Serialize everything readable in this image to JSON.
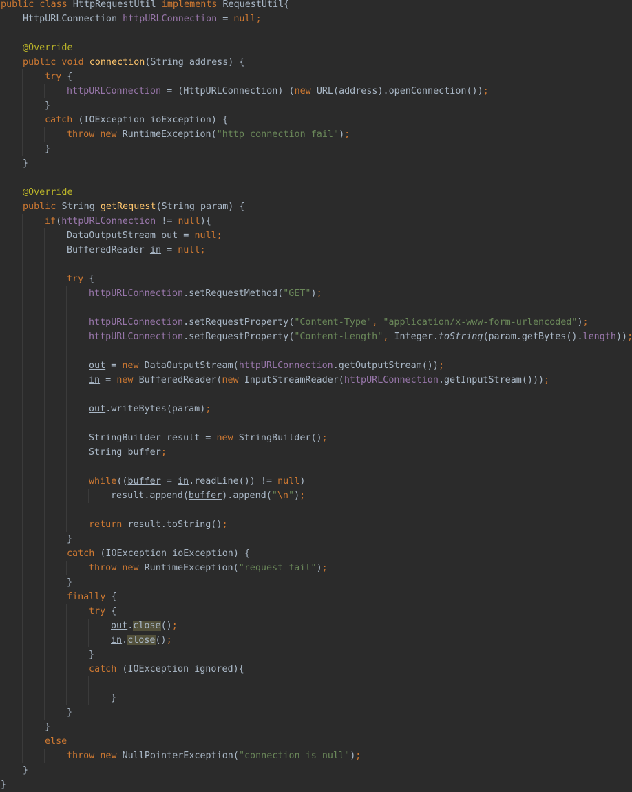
{
  "editor": {
    "language": "java",
    "colors": {
      "background": "#2b2b2b",
      "keyword": "#cc7832",
      "field": "#9876aa",
      "string": "#6a8759",
      "annotation": "#bbb529",
      "method_declaration": "#ffc66d",
      "plain": "#a9b7c6",
      "usage_highlight": "#52503a"
    },
    "lines": [
      {
        "indent": 0,
        "tokens": [
          [
            "kw",
            "public class "
          ],
          [
            "pl",
            "HttpRequestUtil "
          ],
          [
            "kw",
            "implements "
          ],
          [
            "pl",
            "RequestUtil{"
          ]
        ]
      },
      {
        "indent": 1,
        "tokens": [
          [
            "pl",
            "HttpURLConnection "
          ],
          [
            "fld",
            "httpURLConnection "
          ],
          [
            "pl",
            "= "
          ],
          [
            "kw",
            "null;"
          ]
        ]
      },
      {
        "indent": 0,
        "tokens": []
      },
      {
        "indent": 1,
        "tokens": [
          [
            "ann",
            "@Override"
          ]
        ]
      },
      {
        "indent": 1,
        "tokens": [
          [
            "kw",
            "public void "
          ],
          [
            "mth",
            "connection"
          ],
          [
            "pl",
            "(String address) {"
          ]
        ]
      },
      {
        "indent": 2,
        "tokens": [
          [
            "kw",
            "try "
          ],
          [
            "pl",
            "{"
          ]
        ]
      },
      {
        "indent": 3,
        "tokens": [
          [
            "fld",
            "httpURLConnection "
          ],
          [
            "pl",
            "= (HttpURLConnection) ("
          ],
          [
            "kw",
            "new "
          ],
          [
            "pl",
            "URL(address).openConnection())"
          ],
          [
            "kw",
            ";"
          ]
        ]
      },
      {
        "indent": 2,
        "tokens": [
          [
            "pl",
            "}"
          ]
        ]
      },
      {
        "indent": 2,
        "tokens": [
          [
            "kw",
            "catch "
          ],
          [
            "pl",
            "(IOException ioException) {"
          ]
        ]
      },
      {
        "indent": 3,
        "tokens": [
          [
            "kw",
            "throw new "
          ],
          [
            "pl",
            "RuntimeException("
          ],
          [
            "str",
            "\"http connection fail\""
          ],
          [
            "pl",
            ")"
          ],
          [
            "kw",
            ";"
          ]
        ]
      },
      {
        "indent": 2,
        "tokens": [
          [
            "pl",
            "}"
          ]
        ]
      },
      {
        "indent": 1,
        "tokens": [
          [
            "pl",
            "}"
          ]
        ]
      },
      {
        "indent": 0,
        "tokens": []
      },
      {
        "indent": 1,
        "tokens": [
          [
            "ann",
            "@Override"
          ]
        ]
      },
      {
        "indent": 1,
        "tokens": [
          [
            "kw",
            "public "
          ],
          [
            "pl",
            "String "
          ],
          [
            "mth",
            "getRequest"
          ],
          [
            "pl",
            "(String param) {"
          ]
        ]
      },
      {
        "indent": 2,
        "tokens": [
          [
            "kw",
            "if"
          ],
          [
            "pl",
            "("
          ],
          [
            "fld",
            "httpURLConnection "
          ],
          [
            "pl",
            "!= "
          ],
          [
            "kw",
            "null"
          ],
          [
            "pl",
            "){"
          ]
        ]
      },
      {
        "indent": 3,
        "tokens": [
          [
            "pl",
            "DataOutputStream "
          ],
          [
            "pl ul",
            "out"
          ],
          [
            "pl",
            " = "
          ],
          [
            "kw",
            "null;"
          ]
        ]
      },
      {
        "indent": 3,
        "tokens": [
          [
            "pl",
            "BufferedReader "
          ],
          [
            "pl ul",
            "in"
          ],
          [
            "pl",
            " = "
          ],
          [
            "kw",
            "null;"
          ]
        ]
      },
      {
        "indent": 0,
        "tokens": []
      },
      {
        "indent": 3,
        "tokens": [
          [
            "kw",
            "try "
          ],
          [
            "pl",
            "{"
          ]
        ]
      },
      {
        "indent": 4,
        "tokens": [
          [
            "fld",
            "httpURLConnection"
          ],
          [
            "pl",
            ".setRequestMethod("
          ],
          [
            "str",
            "\"GET\""
          ],
          [
            "pl",
            ")"
          ],
          [
            "kw",
            ";"
          ]
        ]
      },
      {
        "indent": 0,
        "tokens": []
      },
      {
        "indent": 4,
        "tokens": [
          [
            "fld",
            "httpURLConnection"
          ],
          [
            "pl",
            ".setRequestProperty("
          ],
          [
            "str",
            "\"Content-Type\""
          ],
          [
            "kw",
            ", "
          ],
          [
            "str",
            "\"application/x-www-form-urlencoded\""
          ],
          [
            "pl",
            ")"
          ],
          [
            "kw",
            ";"
          ]
        ]
      },
      {
        "indent": 4,
        "tokens": [
          [
            "fld",
            "httpURLConnection"
          ],
          [
            "pl",
            ".setRequestProperty("
          ],
          [
            "str",
            "\"Content-Length\""
          ],
          [
            "kw",
            ", "
          ],
          [
            "pl",
            "Integer."
          ],
          [
            "pl it",
            "toString"
          ],
          [
            "pl",
            "(param.getBytes()."
          ],
          [
            "fld",
            "length"
          ],
          [
            "pl",
            "))"
          ],
          [
            "kw",
            ";"
          ]
        ]
      },
      {
        "indent": 0,
        "tokens": []
      },
      {
        "indent": 4,
        "tokens": [
          [
            "pl ul",
            "out"
          ],
          [
            "pl",
            " = "
          ],
          [
            "kw",
            "new "
          ],
          [
            "pl",
            "DataOutputStream("
          ],
          [
            "fld",
            "httpURLConnection"
          ],
          [
            "pl",
            ".getOutputStream())"
          ],
          [
            "kw",
            ";"
          ]
        ]
      },
      {
        "indent": 4,
        "tokens": [
          [
            "pl ul",
            "in"
          ],
          [
            "pl",
            " = "
          ],
          [
            "kw",
            "new "
          ],
          [
            "pl",
            "BufferedReader("
          ],
          [
            "kw",
            "new "
          ],
          [
            "pl",
            "InputStreamReader("
          ],
          [
            "fld",
            "httpURLConnection"
          ],
          [
            "pl",
            ".getInputStream()))"
          ],
          [
            "kw",
            ";"
          ]
        ]
      },
      {
        "indent": 0,
        "tokens": []
      },
      {
        "indent": 4,
        "tokens": [
          [
            "pl ul",
            "out"
          ],
          [
            "pl",
            ".writeBytes(param)"
          ],
          [
            "kw",
            ";"
          ]
        ]
      },
      {
        "indent": 0,
        "tokens": []
      },
      {
        "indent": 4,
        "tokens": [
          [
            "pl",
            "StringBuilder result = "
          ],
          [
            "kw",
            "new "
          ],
          [
            "pl",
            "StringBuilder()"
          ],
          [
            "kw",
            ";"
          ]
        ]
      },
      {
        "indent": 4,
        "tokens": [
          [
            "pl",
            "String "
          ],
          [
            "pl ul",
            "buffer"
          ],
          [
            "kw",
            ";"
          ]
        ]
      },
      {
        "indent": 0,
        "tokens": []
      },
      {
        "indent": 4,
        "tokens": [
          [
            "kw",
            "while"
          ],
          [
            "pl",
            "(("
          ],
          [
            "pl ul",
            "buffer"
          ],
          [
            "pl",
            " = "
          ],
          [
            "pl ul",
            "in"
          ],
          [
            "pl",
            ".readLine()) != "
          ],
          [
            "kw",
            "null"
          ],
          [
            "pl",
            ")"
          ]
        ]
      },
      {
        "indent": 5,
        "tokens": [
          [
            "pl",
            "result.append("
          ],
          [
            "pl ul",
            "buffer"
          ],
          [
            "pl",
            ").append("
          ],
          [
            "str",
            "\""
          ],
          [
            "kw",
            "\\n"
          ],
          [
            "str",
            "\""
          ],
          [
            "pl",
            ")"
          ],
          [
            "kw",
            ";"
          ]
        ]
      },
      {
        "indent": 0,
        "tokens": []
      },
      {
        "indent": 4,
        "tokens": [
          [
            "kw",
            "return "
          ],
          [
            "pl",
            "result.toString()"
          ],
          [
            "kw",
            ";"
          ]
        ]
      },
      {
        "indent": 3,
        "tokens": [
          [
            "pl",
            "}"
          ]
        ]
      },
      {
        "indent": 3,
        "tokens": [
          [
            "kw",
            "catch "
          ],
          [
            "pl",
            "(IOException ioException) {"
          ]
        ]
      },
      {
        "indent": 4,
        "tokens": [
          [
            "kw",
            "throw new "
          ],
          [
            "pl",
            "RuntimeException("
          ],
          [
            "str",
            "\"request fail\""
          ],
          [
            "pl",
            ")"
          ],
          [
            "kw",
            ";"
          ]
        ]
      },
      {
        "indent": 3,
        "tokens": [
          [
            "pl",
            "}"
          ]
        ]
      },
      {
        "indent": 3,
        "tokens": [
          [
            "kw",
            "finally "
          ],
          [
            "pl",
            "{"
          ]
        ]
      },
      {
        "indent": 4,
        "tokens": [
          [
            "kw",
            "try "
          ],
          [
            "pl",
            "{"
          ]
        ]
      },
      {
        "indent": 5,
        "tokens": [
          [
            "pl ul",
            "out"
          ],
          [
            "pl",
            "."
          ],
          [
            "pl hl",
            "close"
          ],
          [
            "pl",
            "()"
          ],
          [
            "kw",
            ";"
          ]
        ]
      },
      {
        "indent": 5,
        "tokens": [
          [
            "pl ul",
            "in"
          ],
          [
            "pl",
            "."
          ],
          [
            "pl hl",
            "close"
          ],
          [
            "pl",
            "()"
          ],
          [
            "kw",
            ";"
          ]
        ]
      },
      {
        "indent": 4,
        "tokens": [
          [
            "pl",
            "}"
          ]
        ]
      },
      {
        "indent": 4,
        "tokens": [
          [
            "kw",
            "catch "
          ],
          [
            "pl",
            "(IOException ignored){"
          ]
        ]
      },
      {
        "indent": 0,
        "tokens": []
      },
      {
        "indent": 5,
        "tokens": [
          [
            "pl",
            "}"
          ]
        ]
      },
      {
        "indent": 3,
        "tokens": [
          [
            "pl",
            "}"
          ]
        ]
      },
      {
        "indent": 2,
        "tokens": [
          [
            "pl",
            "}"
          ]
        ]
      },
      {
        "indent": 2,
        "tokens": [
          [
            "kw",
            "else"
          ]
        ]
      },
      {
        "indent": 3,
        "tokens": [
          [
            "kw",
            "throw new "
          ],
          [
            "pl",
            "NullPointerException("
          ],
          [
            "str",
            "\"connection is null\""
          ],
          [
            "pl",
            ")"
          ],
          [
            "kw",
            ";"
          ]
        ]
      },
      {
        "indent": 1,
        "tokens": [
          [
            "pl",
            "}"
          ]
        ]
      },
      {
        "indent": 0,
        "tokens": [
          [
            "pl",
            "}"
          ]
        ]
      }
    ]
  }
}
